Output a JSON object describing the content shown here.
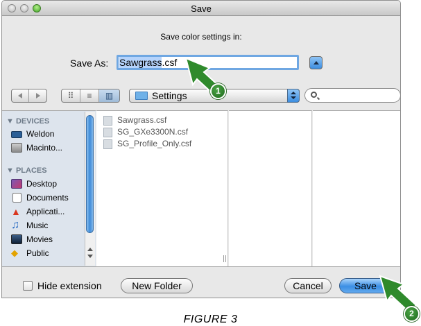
{
  "window": {
    "title": "Save",
    "prompt": "Save color settings in:"
  },
  "save_as": {
    "label": "Save As:",
    "value_selected": "Sawgrass",
    "value_rest": ".csf"
  },
  "toolbar": {
    "location_popup": "Settings"
  },
  "sidebar": {
    "devices_header": "▼ DEVICES",
    "devices": [
      {
        "label": "Weldon",
        "icon": "drive-icon"
      },
      {
        "label": "Macinto...",
        "icon": "hard-disk-icon"
      }
    ],
    "places_header": "▼ PLACES",
    "places": [
      {
        "label": "Desktop",
        "icon": "desktop-icon"
      },
      {
        "label": "Documents",
        "icon": "documents-icon"
      },
      {
        "label": "Applicati...",
        "icon": "applications-icon"
      },
      {
        "label": "Music",
        "icon": "music-icon"
      },
      {
        "label": "Movies",
        "icon": "movies-icon"
      },
      {
        "label": "Public",
        "icon": "public-icon"
      }
    ]
  },
  "files": [
    {
      "name": "Sawgrass.csf"
    },
    {
      "name": "SG_GXe3300N.csf"
    },
    {
      "name": "SG_Profile_Only.csf"
    }
  ],
  "bottom": {
    "hide_extension_label": "Hide extension",
    "new_folder_label": "New Folder",
    "cancel_label": "Cancel",
    "save_label": "Save"
  },
  "callouts": [
    "1",
    "2"
  ],
  "caption": "FIGURE 3"
}
